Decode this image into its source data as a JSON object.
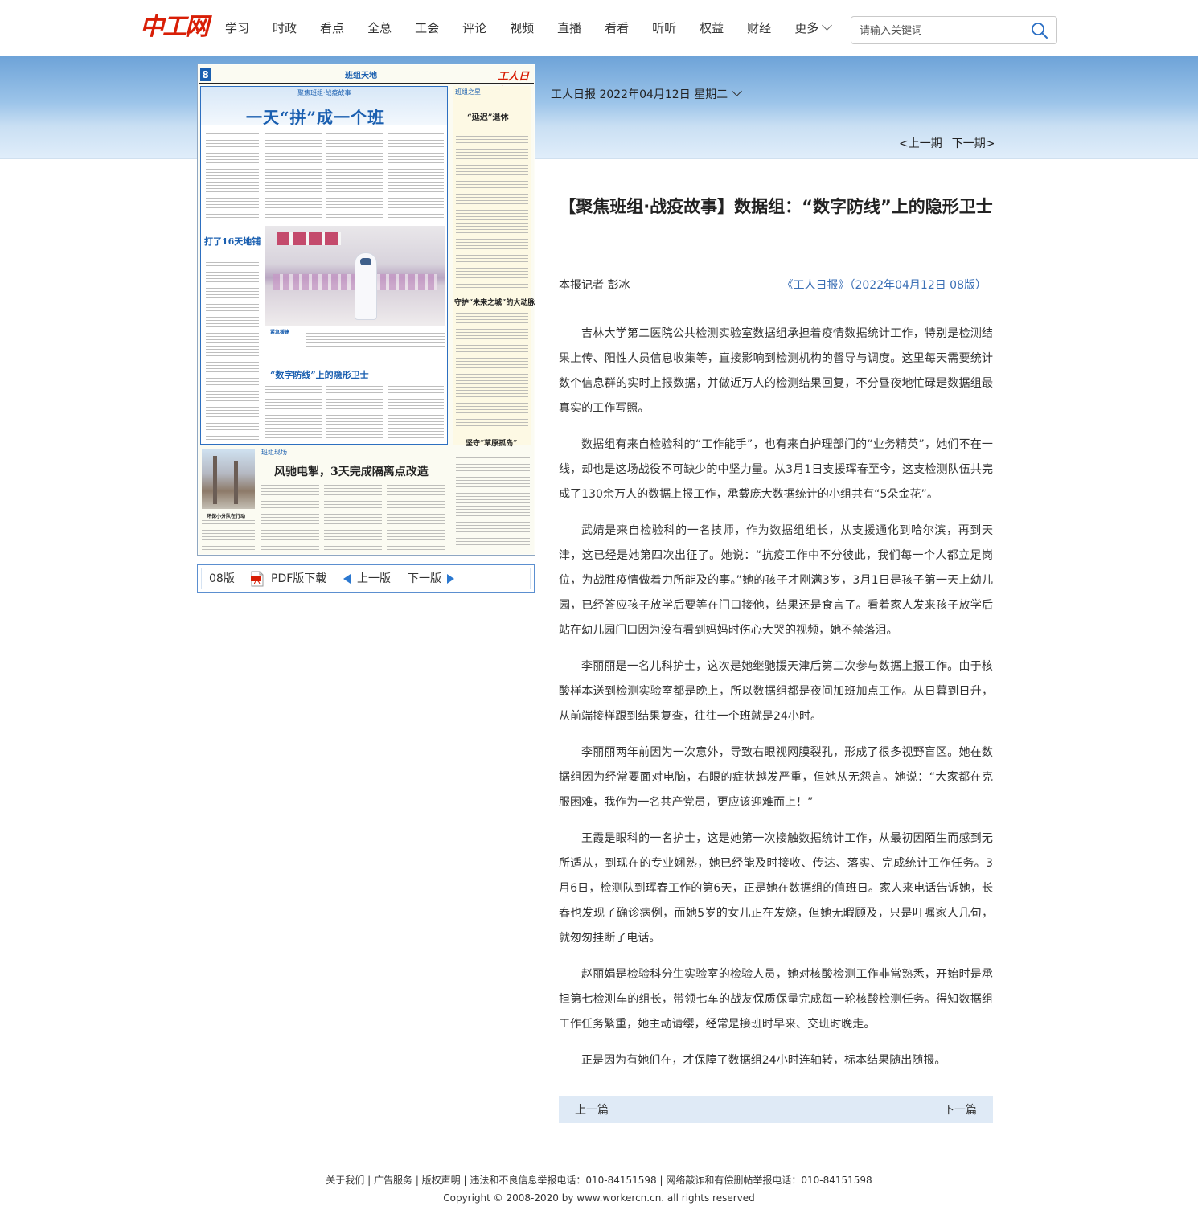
{
  "site": {
    "logo_text": "中工网"
  },
  "nav": {
    "items": [
      "学习",
      "时政",
      "看点",
      "全总",
      "工会",
      "评论",
      "视频",
      "直播",
      "看看",
      "听听",
      "权益",
      "财经"
    ],
    "more": "更多"
  },
  "search": {
    "placeholder": "请输入关键词"
  },
  "edition": {
    "date_label": "工人日报 2022年04月12日 星期二",
    "prev_issue": "<上一期",
    "next_issue": "下一期>"
  },
  "paper": {
    "page_num": "8",
    "page_title": "班组天地",
    "masthead": "工人日报",
    "section_main": "聚焦班组·战疫故事",
    "headline_main": "一天“拼”成一个班",
    "sub_left": "打了16天地铺",
    "photo_caption": "紧急援建",
    "sub_mid": "“数字防线”上的隐形卫士",
    "side_section": "班组之星",
    "side_title_1": "“延迟”退休",
    "side_title_2": "守护“未来之城”的大动脉",
    "side_title_3": "坚守“草原孤岛”",
    "bottom_section": "班组现场",
    "bottom_title": "风驰电掣，3天完成隔离点改造",
    "bottom_caption": "环保小分队在行动"
  },
  "paper_toolbar": {
    "page_label": "08版",
    "pdf_label": "PDF版下载",
    "prev_page": "上一版",
    "next_page": "下一版"
  },
  "article": {
    "title": "【聚焦班组·战疫故事】数据组：“数字防线”上的隐形卫士",
    "author": "本报记者 彭冰",
    "source": "《工人日报》（2022年04月12日 08版）",
    "paragraphs": [
      "吉林大学第二医院公共检测实验室数据组承担着疫情数据统计工作，特别是检测结果上传、阳性人员信息收集等，直接影响到检测机构的督导与调度。这里每天需要统计数个信息群的实时上报数据，并做近万人的检测结果回复，不分昼夜地忙碌是数据组最真实的工作写照。",
      "数据组有来自检验科的“工作能手”，也有来自护理部门的“业务精英”，她们不在一线，却也是这场战役不可缺少的中坚力量。从3月1日支援珲春至今，这支检测队伍共完成了130余万人的数据上报工作，承载庞大数据统计的小组共有“5朵金花”。",
      "武婧是来自检验科的一名技师，作为数据组组长，从支援通化到哈尔滨，再到天津，这已经是她第四次出征了。她说：“抗疫工作中不分彼此，我们每一个人都立足岗位，为战胜疫情做着力所能及的事。”她的孩子才刚满3岁，3月1日是孩子第一天上幼儿园，已经答应孩子放学后要等在门口接他，结果还是食言了。看着家人发来孩子放学后站在幼儿园门口因为没有看到妈妈时伤心大哭的视频，她不禁落泪。",
      "李丽丽是一名儿科护士，这次是她继驰援天津后第二次参与数据上报工作。由于核酸样本送到检测实验室都是晚上，所以数据组都是夜间加班加点工作。从日暮到日升，从前端接样跟到结果复查，往往一个班就是24小时。",
      "李丽丽两年前因为一次意外，导致右眼视网膜裂孔，形成了很多视野盲区。她在数据组因为经常要面对电脑，右眼的症状越发严重，但她从无怨言。她说：“大家都在克服困难，我作为一名共产党员，更应该迎难而上！”",
      "王霞是眼科的一名护士，这是她第一次接触数据统计工作，从最初因陌生而感到无所适从，到现在的专业娴熟，她已经能及时接收、传达、落实、完成统计工作任务。3月6日，检测队到珲春工作的第6天，正是她在数据组的值班日。家人来电话告诉她，长春也发现了确诊病例，而她5岁的女儿正在发烧，但她无暇顾及，只是叮嘱家人几句，就匆匆挂断了电话。",
      "赵丽娟是检验科分生实验室的检验人员，她对核酸检测工作非常熟悉，开始时是承担第七检测车的组长，带领七车的战友保质保量完成每一轮核酸检测任务。得知数据组工作任务繁重，她主动请缨，经常是接班时早来、交班时晚走。",
      "正是因为有她们在，才保障了数据组24小时连轴转，标本结果随出随报。"
    ],
    "prev_article": "上一篇",
    "next_article": "下一篇"
  },
  "footer": {
    "links": [
      "关于我们",
      "广告服务",
      "版权声明",
      "违法和不良信息举报电话：010-84151598",
      "网络敲诈和有偿删帖举报电话：010-84151598"
    ],
    "copyright": "Copyright © 2008-2020 by www.workercn.cn. all rights reserved"
  },
  "colors": {
    "brand_red": "#d81e06",
    "link_blue": "#3a6fb5",
    "paper_blue": "#1a5fb0"
  }
}
